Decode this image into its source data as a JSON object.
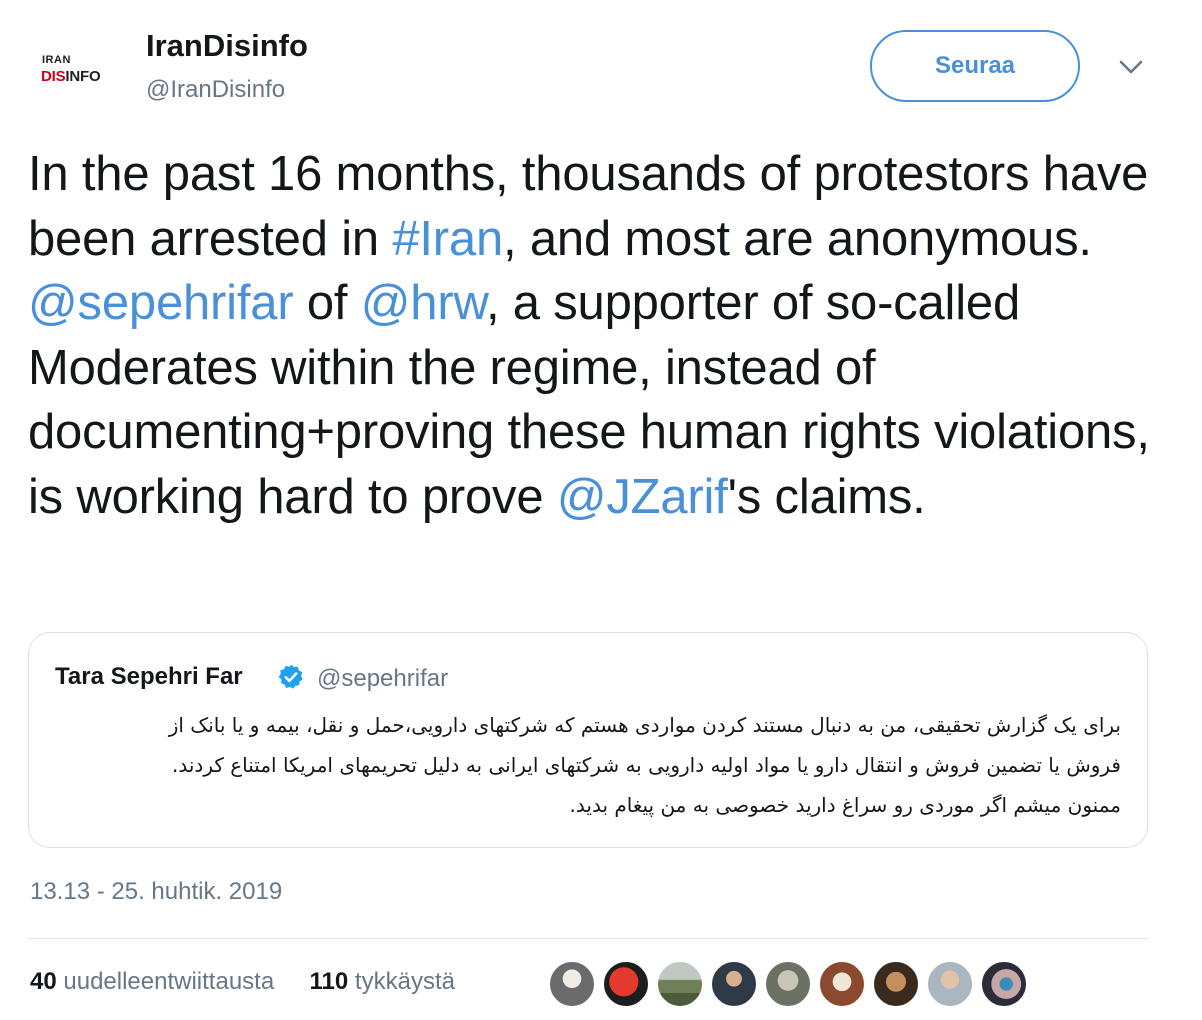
{
  "author": {
    "avatar_text_top": "IRAN",
    "avatar_text_red": "DIS",
    "avatar_text_rest": "INFO",
    "display_name": "IranDisinfo",
    "handle": "@IranDisinfo"
  },
  "actions": {
    "follow_label": "Seuraa",
    "menu_icon": "chevron-down-icon"
  },
  "tweet": {
    "segments": [
      {
        "text": "In the past 16 months, thousands of protestors have been arrested in ",
        "link": false
      },
      {
        "text": "#Iran",
        "link": true
      },
      {
        "text": ", and most are anonymous. ",
        "link": false
      },
      {
        "text": "@sepehrifar",
        "link": true
      },
      {
        "text": " of ",
        "link": false
      },
      {
        "text": "@hrw",
        "link": true
      },
      {
        "text": ", a supporter of so-called Moderates within the regime, instead of documenting+proving these human rights violations, is working hard to prove ",
        "link": false
      },
      {
        "text": "@JZarif",
        "link": true
      },
      {
        "text": "'s claims.",
        "link": false
      }
    ]
  },
  "quoted_tweet": {
    "display_name": "Tara Sepehri Far",
    "verified_icon": "verified-badge-icon",
    "handle": "@sepehrifar",
    "lines": [
      "برای یک گزارش تحقیقی، من به دنبال مستند کردن مواردی هستم که شرکتهای دارویی،حمل و نقل، بیمه و یا بانک از",
      "فروش یا تضمین فروش و انتقال دارو یا مواد اولیه دارویی به شرکتهای ایرانی به دلیل تحریمهای امریکا امتناع کردند.",
      "ممنون میشم اگر موردی رو سراغ دارید خصوصی به من پیغام بدید."
    ]
  },
  "timestamp": "13.13 - 25. huhtik. 2019",
  "stats": {
    "retweets_count": "40",
    "retweets_label": "uudelleentwiittausta",
    "likes_count": "110",
    "likes_label": "tykkäystä"
  },
  "colors": {
    "link": "#4a90d9",
    "secondary_text": "#657786",
    "brand_red": "#d0021b"
  }
}
